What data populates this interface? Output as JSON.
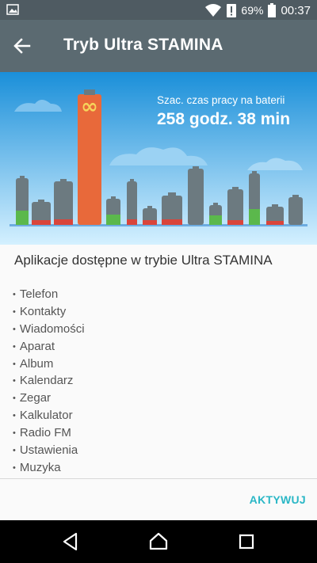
{
  "status_bar": {
    "battery_percent": "69%",
    "time": "00:37",
    "left_icon": "image-icon",
    "icons": [
      "wifi-icon",
      "alert-icon",
      "battery-icon"
    ]
  },
  "app_bar": {
    "title": "Tryb Ultra STAMINA",
    "back_icon": "arrow-back-icon"
  },
  "hero": {
    "estimate_label": "Szac. czas pracy na baterii",
    "estimate_value": "258 godz. 38 min",
    "infinity_symbol": "∞",
    "colors": {
      "sky_top": "#1a8fd9",
      "sky_bottom": "#cfeeff",
      "highlight_battery": "#e8693a",
      "battery_gray": "#6c7a80",
      "battery_green": "#5bb84c",
      "battery_red": "#d9453b",
      "cloud": "#7fc3ee"
    }
  },
  "main": {
    "heading": "Aplikacje dostępne w trybie Ultra STAMINA",
    "apps": [
      "Telefon",
      "Kontakty",
      "Wiadomości",
      "Aparat",
      "Album",
      "Kalendarz",
      "Zegar",
      "Kalkulator",
      "Radio FM",
      "Ustawienia",
      "Muzyka"
    ]
  },
  "footer": {
    "activate_label": "AKTYWUJ",
    "accent_color": "#2ab7c6"
  },
  "nav_bar": {
    "icons": [
      "back-triangle-icon",
      "home-icon",
      "recents-icon"
    ]
  }
}
